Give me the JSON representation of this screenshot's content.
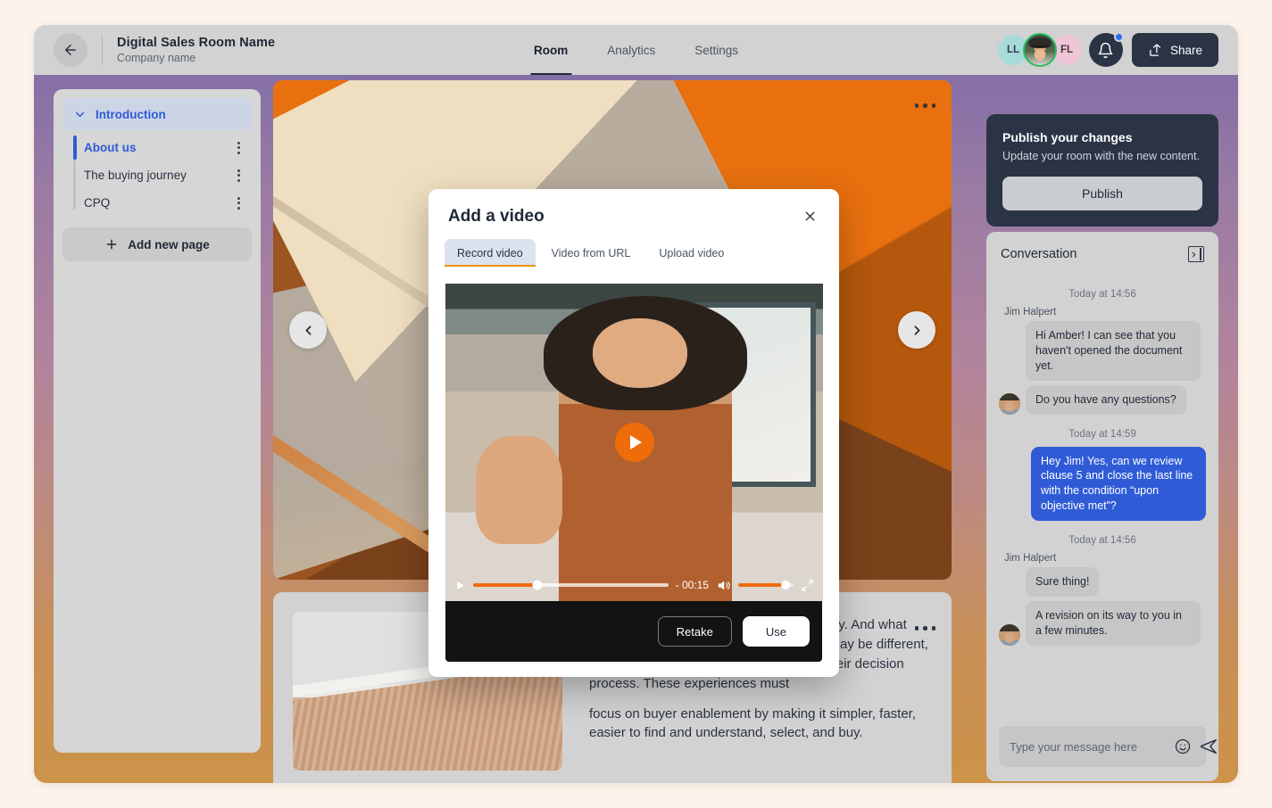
{
  "header": {
    "back_icon": "arrow-left-icon",
    "room_title": "Digital Sales Room Name",
    "company_name": "Company name",
    "tabs": [
      {
        "label": "Room",
        "active": true
      },
      {
        "label": "Analytics",
        "active": false
      },
      {
        "label": "Settings",
        "active": false
      }
    ],
    "avatars": [
      {
        "initials": "LL",
        "color": "#a7dbdb"
      },
      {
        "initials": "",
        "color": "#25c05f"
      },
      {
        "initials": "FL",
        "color": "#eec6d8"
      }
    ],
    "notifications_icon": "bell-icon",
    "has_unread_notification": true,
    "share_label": "Share",
    "share_icon": "share-icon"
  },
  "sidebar": {
    "section": {
      "label": "Introduction",
      "chevron_icon": "chevron-down-icon",
      "expanded": true
    },
    "pages": [
      {
        "label": "About us",
        "active": true
      },
      {
        "label": "The buying journey",
        "active": false
      },
      {
        "label": "CPQ",
        "active": false
      }
    ],
    "add_page_label": "Add new page",
    "add_page_icon": "plus-icon"
  },
  "main": {
    "hero": {
      "menu_icon": "more-horizontal-icon",
      "prev_icon": "chevron-left-icon",
      "next_icon": "chevron-right-icon"
    },
    "content_card": {
      "menu_icon": "more-horizontal-icon",
      "paragraphs": [
        "…relevance, context, choice, and simplicity. And what each of those represents in the moment may be different, depending on where your buyers are in their decision process. These experiences must",
        "focus on buyer enablement by making it simpler, faster, easier to find and understand, select, and buy."
      ]
    }
  },
  "publish": {
    "title": "Publish your changes",
    "subtitle": "Update your room with the new content.",
    "button_label": "Publish"
  },
  "conversation": {
    "title": "Conversation",
    "collapse_icon": "panel-collapse-icon",
    "groups": [
      {
        "timestamp": "Today at 14:56",
        "sender": "Jim Halpert",
        "side": "left",
        "messages": [
          "Hi Amber! I can see that you haven't opened the document yet.",
          "Do you have any questions?"
        ]
      },
      {
        "timestamp": "Today at 14:59",
        "sender": "",
        "side": "right",
        "messages": [
          "Hey Jim! Yes, can we review clause 5 and close the last line with the condition “upon objective met”?"
        ]
      },
      {
        "timestamp": "Today at 14:56",
        "sender": "Jim Halpert",
        "side": "left",
        "messages": [
          "Sure thing!",
          "A revision on its way to you in a few minutes."
        ]
      }
    ],
    "input_placeholder": "Type your message here",
    "emoji_icon": "smiley-icon",
    "send_icon": "send-icon"
  },
  "modal": {
    "title": "Add a video",
    "close_icon": "close-icon",
    "tabs": [
      {
        "label": "Record video",
        "active": true
      },
      {
        "label": "Video from URL",
        "active": false
      },
      {
        "label": "Upload video",
        "active": false
      }
    ],
    "player": {
      "play_icon": "play-icon",
      "small_play_icon": "play-icon",
      "time_remaining": "- 00:15",
      "volume_icon": "volume-icon",
      "fullscreen_icon": "fullscreen-icon",
      "progress_percent": 33,
      "volume_percent": 86
    },
    "retake_label": "Retake",
    "use_label": "Use"
  },
  "colors": {
    "page_background": "#fdf3ea",
    "accent_orange": "#ef6c0b",
    "accent_blue": "#2f5bd7",
    "dark_navy": "#2b3445"
  }
}
